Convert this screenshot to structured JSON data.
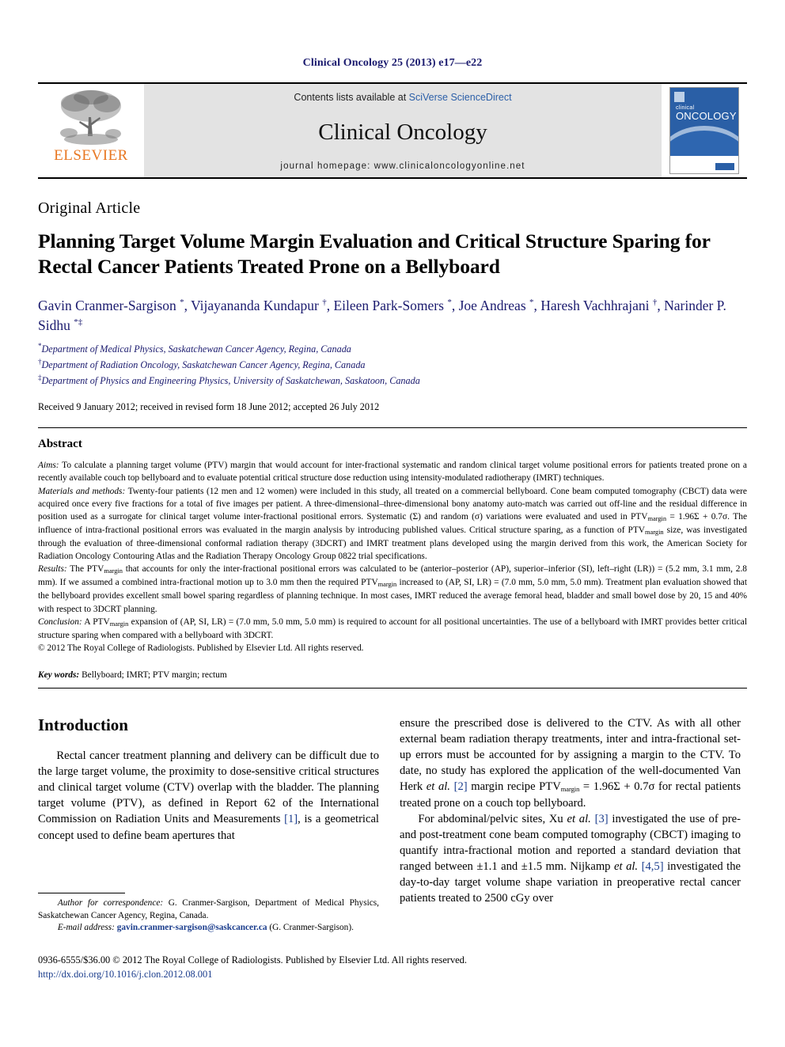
{
  "running_head": "Clinical Oncology 25 (2013) e17—e22",
  "masthead": {
    "publisher_name": "ELSEVIER",
    "publisher_logo_icon": "elsevier-tree-icon",
    "contents_prefix": "Contents lists available at ",
    "contents_link": "SciVerse ScienceDirect",
    "journal_name": "Clinical Oncology",
    "homepage": "journal homepage: www.clinicaloncologyonline.net",
    "cover": {
      "title_line1": "clinical",
      "title_line2": "ONCOLOGY",
      "accent_color": "#2a5fa6"
    }
  },
  "article": {
    "type": "Original Article",
    "title": "Planning Target Volume Margin Evaluation and Critical Structure Sparing for Rectal Cancer Patients Treated Prone on a Bellyboard",
    "authors_html": "Gavin Cranmer-Sargison <sup>*</sup>, Vijayananda Kundapur <sup>†</sup>, Eileen Park-Somers <sup>*</sup>, Joe Andreas <sup>*</sup>, Haresh Vachhrajani <sup>†</sup>, Narinder P. Sidhu <sup>*‡</sup>",
    "affiliations": [
      {
        "marker": "*",
        "text": "Department of Medical Physics, Saskatchewan Cancer Agency, Regina, Canada"
      },
      {
        "marker": "†",
        "text": "Department of Radiation Oncology, Saskatchewan Cancer Agency, Regina, Canada"
      },
      {
        "marker": "‡",
        "text": "Department of Physics and Engineering Physics, University of Saskatchewan, Saskatoon, Canada"
      }
    ],
    "history": "Received 9 January 2012; received in revised form 18 June 2012; accepted 26 July 2012"
  },
  "abstract": {
    "heading": "Abstract",
    "aims_label": "Aims:",
    "aims_text": " To calculate a planning target volume (PTV) margin that would account for inter-fractional systematic and random clinical target volume positional errors for patients treated prone on a recently available couch top bellyboard and to evaluate potential critical structure dose reduction using intensity-modulated radiotherapy (IMRT) techniques.",
    "methods_label": "Materials and methods:",
    "methods_text_1": " Twenty-four patients (12 men and 12 women) were included in this study, all treated on a commercial bellyboard. Cone beam computed tomography (CBCT) data were acquired once every five fractions for a total of five images per patient. A three-dimensional–three-dimensional bony anatomy auto-match was carried out off-line and the residual difference in position used as a surrogate for clinical target volume inter-fractional positional errors. Systematic (Σ) and random (σ) variations were evaluated and used in PTV",
    "methods_sub_1": "margin",
    "methods_text_2": " = 1.96Σ + 0.7σ. The influence of intra-fractional positional errors was evaluated in the margin analysis by introducing published values. Critical structure sparing, as a function of PTV",
    "methods_sub_2": "margin",
    "methods_text_3": " size, was investigated through the evaluation of three-dimensional conformal radiation therapy (3DCRT) and IMRT treatment plans developed using the margin derived from this work, the American Society for Radiation Oncology Contouring Atlas and the Radiation Therapy Oncology Group 0822 trial specifications.",
    "results_label": "Results:",
    "results_text_1": " The PTV",
    "results_sub_1": "margin",
    "results_text_2": " that accounts for only the inter-fractional positional errors was calculated to be (anterior–posterior (AP), superior–inferior (SI), left–right (LR)) = (5.2 mm, 3.1 mm, 2.8 mm). If we assumed a combined intra-fractional motion up to 3.0 mm then the required PTV",
    "results_sub_2": "margin",
    "results_text_3": " increased to (AP, SI, LR) = (7.0 mm, 5.0 mm, 5.0 mm). Treatment plan evaluation showed that the bellyboard provides excellent small bowel sparing regardless of planning technique. In most cases, IMRT reduced the average femoral head, bladder and small bowel dose by 20, 15 and 40% with respect to 3DCRT planning.",
    "conclusion_label": "Conclusion:",
    "conclusion_text_1": " A PTV",
    "conclusion_sub_1": "margin",
    "conclusion_text_2": " expansion of (AP, SI, LR) = (7.0 mm, 5.0 mm, 5.0 mm) is required to account for all positional uncertainties. The use of a bellyboard with IMRT provides better critical structure sparing when compared with a bellyboard with 3DCRT.",
    "copyright_line": "© 2012 The Royal College of Radiologists. Published by Elsevier Ltd. All rights reserved.",
    "keywords_label": "Key words:",
    "keywords_text": " Bellyboard; IMRT; PTV margin; rectum"
  },
  "introduction": {
    "heading": "Introduction",
    "left_p1_a": "Rectal cancer treatment planning and delivery can be difficult due to the large target volume, the proximity to dose-sensitive critical structures and clinical target volume (CTV) overlap with the bladder. The planning target volume (PTV), as defined in Report 62 of the International Commission on Radiation Units and Measurements ",
    "left_p1_ref": "[1]",
    "left_p1_b": ", is a geometrical concept used to define beam apertures that",
    "right_p1_a": "ensure the prescribed dose is delivered to the CTV. As with all other external beam radiation therapy treatments, inter and intra-fractional set-up errors must be accounted for by assigning a margin to the CTV. To date, no study has explored the application of the well-documented Van Herk ",
    "right_p1_ital": "et al.",
    "right_p1_ref": "[2]",
    "right_p1_b": " margin recipe PTV",
    "right_p1_sub": "margin",
    "right_p1_c": " = 1.96Σ + 0.7σ for rectal patients treated prone on a couch top bellyboard.",
    "right_p2_a": "For abdominal/pelvic sites, Xu ",
    "right_p2_ital": "et al.",
    "right_p2_ref1": "[3]",
    "right_p2_b": " investigated the use of pre- and post-treatment cone beam computed tomography (CBCT) imaging to quantify intra-fractional motion and reported a standard deviation that ranged between ±1.1 and ±1.5 mm. Nijkamp ",
    "right_p2_ital2": "et al.",
    "right_p2_ref2": "[4,5]",
    "right_p2_c": " investigated the day-to-day target volume shape variation in preoperative rectal cancer patients treated to 2500 cGy over"
  },
  "footnotes": {
    "correspondence_label": "Author for correspondence:",
    "correspondence_text": " G. Cranmer-Sargison, Department of Medical Physics, Saskatchewan Cancer Agency, Regina, Canada.",
    "email_label": "E-mail address:",
    "email_value": "gavin.cranmer-sargison@saskcancer.ca",
    "email_suffix": " (G. Cranmer-Sargison)."
  },
  "page_footer": {
    "issn_line": "0936-6555/$36.00 © 2012 The Royal College of Radiologists. Published by Elsevier Ltd. All rights reserved.",
    "doi": "http://dx.doi.org/10.1016/j.clon.2012.08.001"
  }
}
